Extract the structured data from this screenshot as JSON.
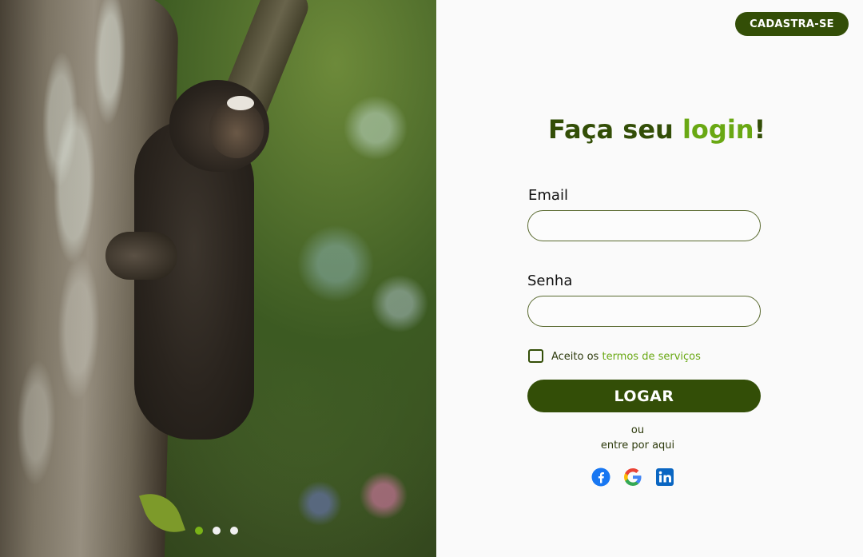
{
  "header": {
    "register_label": "CADASTRA-SE"
  },
  "login": {
    "title_pre": "Faça seu ",
    "title_accent": "login",
    "title_post": "!",
    "email_label": "Email",
    "email_value": "",
    "password_label": "Senha",
    "password_value": "",
    "terms_pre": "Aceito os ",
    "terms_link": "termos de serviços",
    "terms_checked": false,
    "submit_label": "LOGAR",
    "or_text": "ou",
    "alt_text": "entre por aqui"
  },
  "socials": [
    "facebook-icon",
    "google-icon",
    "linkedin-icon"
  ],
  "carousel": {
    "count": 3,
    "active_index": 0
  },
  "colors": {
    "primary": "#334e07",
    "accent": "#69a813",
    "dot_active": "#7ab317",
    "facebook": "#1877f2",
    "linkedin": "#0a66c2"
  }
}
